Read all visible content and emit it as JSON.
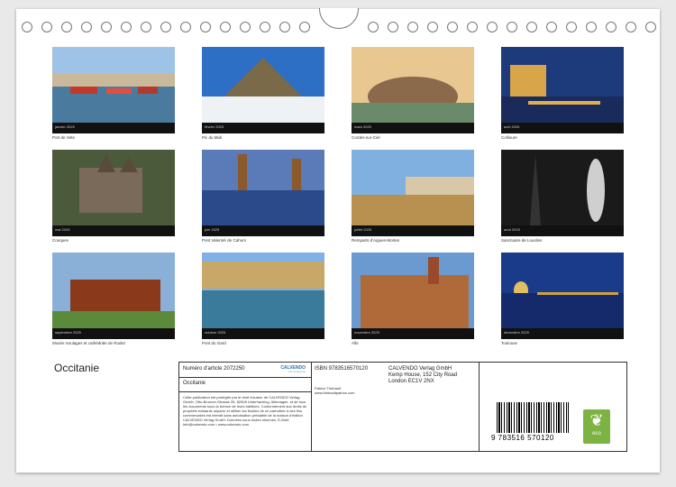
{
  "calendar_title": "Occitanie",
  "tiles": [
    {
      "month": "janvier 2025",
      "caption": "Port de Sète"
    },
    {
      "month": "février 2025",
      "caption": "Pic du Midi"
    },
    {
      "month": "mars 2025",
      "caption": "Cordes-sur-Ciel"
    },
    {
      "month": "avril 2025",
      "caption": "Collioure"
    },
    {
      "month": "mai 2025",
      "caption": "Conques"
    },
    {
      "month": "juin 2025",
      "caption": "Pont Valentré de Cahors"
    },
    {
      "month": "juillet 2025",
      "caption": "Remparts d'Aigues-Mortes"
    },
    {
      "month": "août 2025",
      "caption": "Sanctuaire de Lourdes"
    },
    {
      "month": "septembre 2025",
      "caption": "Musée Soulages et cathédrale de Rodez"
    },
    {
      "month": "octobre 2025",
      "caption": "Pont du Gard"
    },
    {
      "month": "novembre 2025",
      "caption": "Albi"
    },
    {
      "month": "décembre 2025",
      "caption": "Toulouse"
    }
  ],
  "info": {
    "article": "Numéro d'article 2072250",
    "name": "Occitanie",
    "legal": "Cette publication est protégée par le droit d'auteur de CALVENDO Verlag GmbH, Otto-Brunner-Strasse 39, 82008 Unterhaching, Allemagne, et de tous les documents sous la licence de leurs bailleurs. Conformément aux droits de propriété existants séparer et utiliser les feuilles de ce calendrier à des fins commerciales est interdit sans autorisation préalable de la maison d'édition CALVENDO Verlag GmbH. Données sous toutes réserves. E-Mail: info@calvendo.com • www.calvendo.com",
    "isbn": "ISBN 9783516570120",
    "author": "Patrice Thebault",
    "author_web": "www.thebaultpatrice.com",
    "publisher_lines": [
      "CALVENDO Verlag GmbH",
      "Kemp House, 152 City Road",
      "London EC1V 2NX"
    ],
    "barcode_number": "9 783516 570120",
    "calvendo_logo": "CALVENDO",
    "calvendo_sub": "Das Verlagshaus",
    "eco_label": "eco"
  }
}
